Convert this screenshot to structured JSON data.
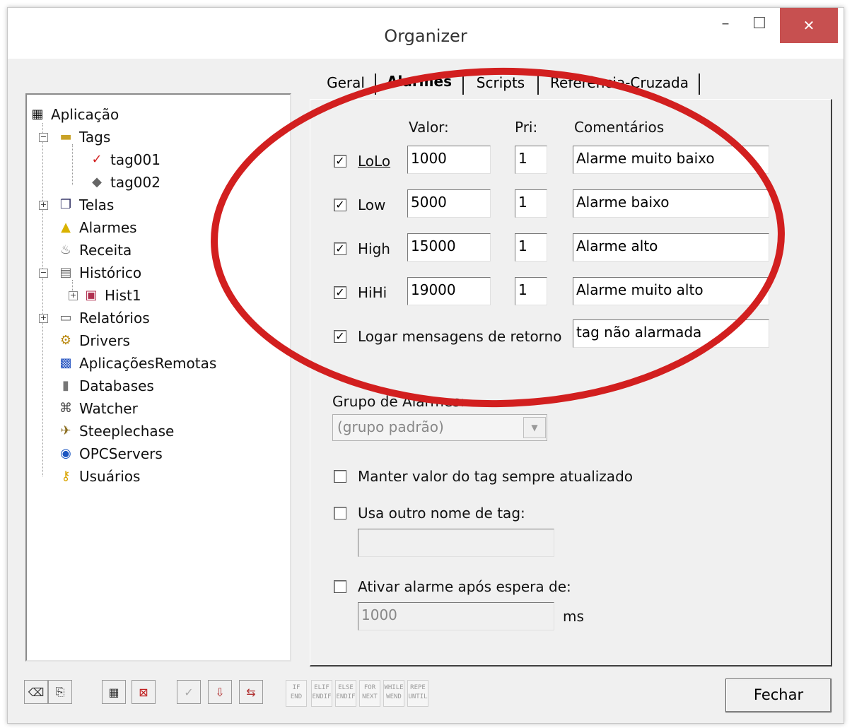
{
  "window": {
    "title": "Organizer",
    "minimize": "–",
    "maximize": "☐",
    "close": "✕"
  },
  "tree": [
    {
      "label": "Aplicação",
      "icon": "application-icon"
    },
    {
      "label": "Tags",
      "icon": "folder-icon"
    },
    {
      "label": "tag001",
      "icon": "alarm-tag-icon"
    },
    {
      "label": "tag002",
      "icon": "tag-icon"
    },
    {
      "label": "Telas",
      "icon": "screens-icon"
    },
    {
      "label": "Alarmes",
      "icon": "bell-icon"
    },
    {
      "label": "Receita",
      "icon": "recipe-icon"
    },
    {
      "label": "Histórico",
      "icon": "history-icon"
    },
    {
      "label": "Hist1",
      "icon": "disk-icon"
    },
    {
      "label": "Relatórios",
      "icon": "report-icon"
    },
    {
      "label": "Drivers",
      "icon": "drivers-icon"
    },
    {
      "label": "AplicaçõesRemotas",
      "icon": "network-icon"
    },
    {
      "label": "Databases",
      "icon": "database-icon"
    },
    {
      "label": "Watcher",
      "icon": "watcher-icon"
    },
    {
      "label": "Steeplechase",
      "icon": "steeplechase-icon"
    },
    {
      "label": "OPCServers",
      "icon": "opc-icon"
    },
    {
      "label": "Usuários",
      "icon": "key-icon"
    }
  ],
  "tabs": [
    "Geral",
    "Alarmes",
    "Scripts",
    "Referência-Cruzada"
  ],
  "alarms": {
    "headers": {
      "value": "Valor:",
      "pri": "Pri:",
      "comment": "Comentários"
    },
    "rows": [
      {
        "label": "LoLo",
        "checked": true,
        "value": "1000",
        "pri": "1",
        "comment": "Alarme muito baixo"
      },
      {
        "label": "Low",
        "checked": true,
        "value": "5000",
        "pri": "1",
        "comment": "Alarme baixo"
      },
      {
        "label": "High",
        "checked": true,
        "value": "15000",
        "pri": "1",
        "comment": "Alarme alto"
      },
      {
        "label": "HiHi",
        "checked": true,
        "value": "19000",
        "pri": "1",
        "comment": "Alarme muito alto"
      }
    ],
    "log_return": {
      "label": "Logar mensagens de retorno",
      "checked": true,
      "value": "tag não alarmada"
    },
    "group_label": "Grupo de Alarmes:",
    "group_value": "(grupo padrão)",
    "keep_updated": {
      "label": "Manter valor do tag sempre atualizado",
      "checked": false
    },
    "other_tag": {
      "label": "Usa outro nome de tag:",
      "checked": false,
      "value": ""
    },
    "delay": {
      "label": "Ativar alarme após espera de:",
      "checked": false,
      "value": "1000",
      "unit": "ms"
    }
  },
  "toolbar_text_buttons": [
    {
      "top": "IF",
      "bottom": "END"
    },
    {
      "top": "ELIF",
      "bottom": "ENDIF"
    },
    {
      "top": "ELSE",
      "bottom": "ENDIF"
    },
    {
      "top": "FOR",
      "bottom": "NEXT"
    },
    {
      "top": "WHILE",
      "bottom": "WEND"
    },
    {
      "top": "REPE",
      "bottom": "UNTIL"
    }
  ],
  "close_button": "Fechar",
  "colors": {
    "highlight_ellipse": "#d21f1f",
    "close_bg": "#c75050"
  }
}
